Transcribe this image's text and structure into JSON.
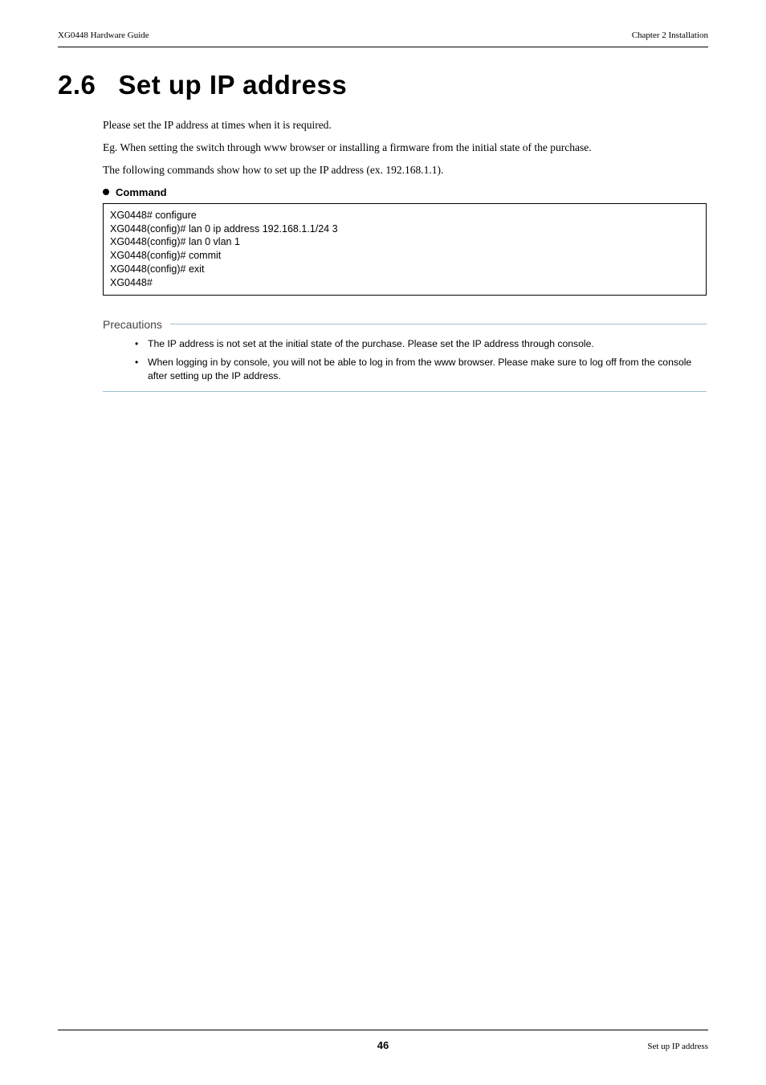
{
  "header": {
    "left": "XG0448 Hardware Guide",
    "right": "Chapter 2 Installation"
  },
  "section": {
    "number": "2.6",
    "title": "Set up IP address"
  },
  "paragraphs": {
    "p1": "Please set the IP address at times when it is required.",
    "p2": "Eg. When setting the switch through www browser or installing a firmware from the initial state of the purchase.",
    "p3": "The following commands show how to set up the IP address (ex. 192.168.1.1)."
  },
  "command": {
    "heading": "Command",
    "lines": "XG0448# configure\nXG0448(config)# lan 0 ip address 192.168.1.1/24 3\nXG0448(config)# lan 0 vlan 1\nXG0448(config)# commit\nXG0448(config)# exit\nXG0448#"
  },
  "precautions": {
    "heading": "Precautions",
    "items": [
      "The IP address is not set at the initial state of the purchase. Please set the IP address through console.",
      "When logging in by console, you will not be able to log in from the www browser. Please make sure to log off from the console after setting up the IP address."
    ]
  },
  "footer": {
    "page": "46",
    "right": "Set up IP address"
  }
}
